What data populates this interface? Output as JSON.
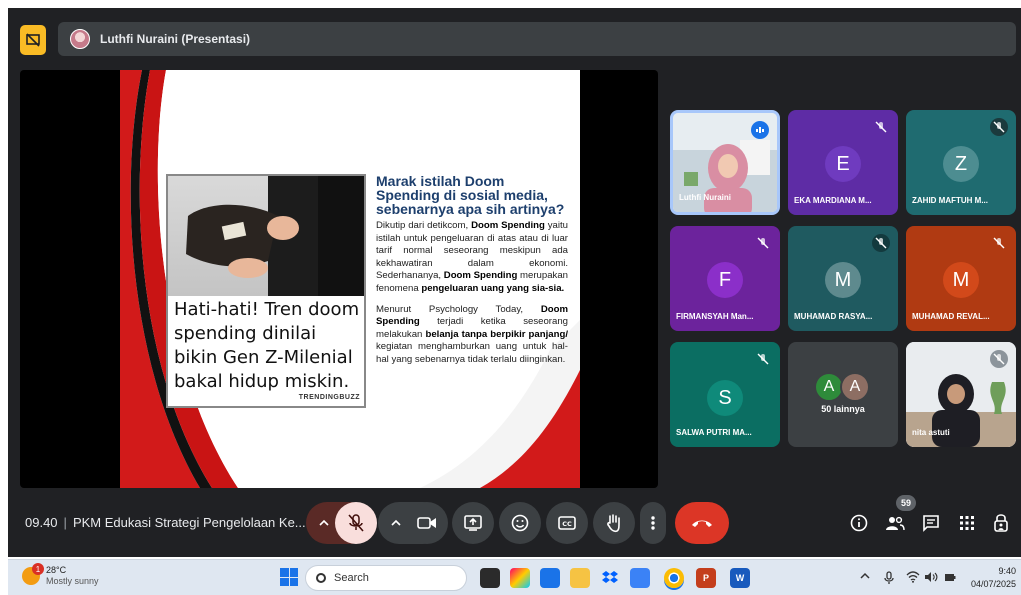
{
  "meeting": {
    "presenter_label": "Luthfi Nuraini (Presentasi)",
    "time": "09.40",
    "title": "PKM Edukasi Strategi Pengelolaan Ke...",
    "participant_count": "59"
  },
  "slide": {
    "caption": "Hati-hati! Tren doom spending dinilai bikin Gen Z-Milenial bakal hidup miskin.",
    "brand": "TRENDINGBUZZ",
    "heading": "Marak istilah Doom Spending di sosial media, sebenarnya apa sih artinya?",
    "p1_a": "Dikutip dari detikcom, ",
    "p1_b": "Doom Spending",
    "p1_c": " yaitu istilah untuk pengeluaran di atas atau di luar tarif normal seseorang meskipun ada kekhawatiran dalam ekonomi. Sederhananya, ",
    "p1_d": "Doom Spending",
    "p1_e": " merupakan fenomena ",
    "p1_f": "pengeluaran uang yang sia-sia.",
    "p2_a": "Menurut Psychology Today, ",
    "p2_b": "Doom Spending",
    "p2_c": " terjadi ketika seseorang melakukan ",
    "p2_d": "belanja tanpa berpikir panjang/",
    "p2_e": " kegiatan menghamburkan uang untuk hal-hal yang sebenarnya tidak terlalu diinginkan."
  },
  "participants": [
    {
      "name": "Luthfi Nuraini",
      "initial": "",
      "color": "#d8e3ec"
    },
    {
      "name": "EKA MARDIANA M...",
      "initial": "E",
      "color": "#5e2ca5"
    },
    {
      "name": "ZAHID MAFTUH M...",
      "initial": "Z",
      "color": "#1f6b70"
    },
    {
      "name": "FIRMANSYAH Man...",
      "initial": "F",
      "color": "#6c239c"
    },
    {
      "name": "MUHAMAD RASYA...",
      "initial": "M",
      "color": "#1f5a60"
    },
    {
      "name": "MUHAMAD REVAL...",
      "initial": "M",
      "color": "#b03a12"
    },
    {
      "name": "SALWA PUTRI MA...",
      "initial": "S",
      "color": "#0b6e62"
    },
    {
      "name": "nita astuti",
      "initial": "",
      "color": "#cfd6dd"
    }
  ],
  "others": {
    "label": "50 lainnya",
    "initial_1": "A",
    "initial_2": "A"
  },
  "taskbar": {
    "temperature": "28°C",
    "weather": "Mostly sunny",
    "weather_badge": "1",
    "search_placeholder": "Search",
    "time": "9:40",
    "date": "04/07/2025"
  },
  "colors": {
    "meet_bg": "#202124",
    "present_yellow": "#f9bb25",
    "end_call_red": "#dc3626",
    "mic_off_pink": "#f9dedc",
    "slide_heading_blue": "#1d3f6d"
  }
}
